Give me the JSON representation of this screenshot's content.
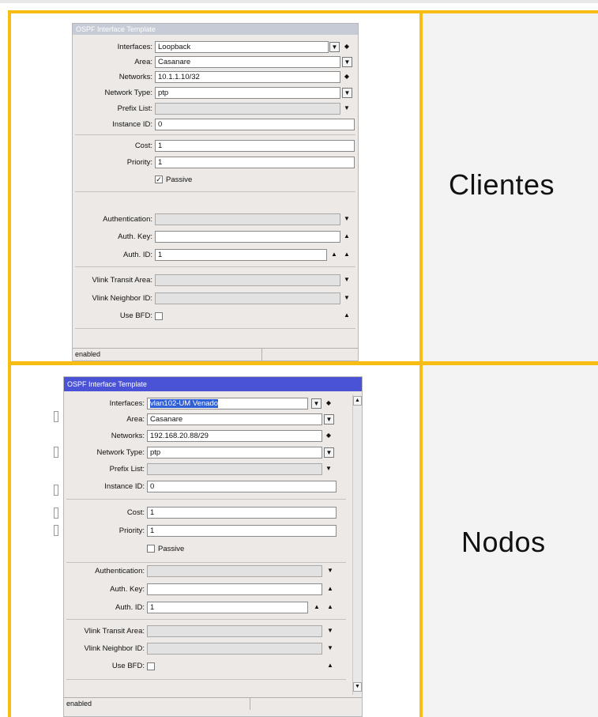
{
  "row1": {
    "label": "Clientes",
    "dialog": {
      "title": "OSPF Interface Template",
      "fields": {
        "interfaces": {
          "label": "Interfaces:",
          "value": "Loopback"
        },
        "area": {
          "label": "Area:",
          "value": "Casanare"
        },
        "networks": {
          "label": "Networks:",
          "value": "10.1.1.10/32"
        },
        "network_type": {
          "label": "Network Type:",
          "value": "ptp"
        },
        "prefix_list": {
          "label": "Prefix List:",
          "value": ""
        },
        "instance_id": {
          "label": "Instance ID:",
          "value": "0"
        },
        "cost": {
          "label": "Cost:",
          "value": "1"
        },
        "priority": {
          "label": "Priority:",
          "value": "1"
        },
        "passive": {
          "label": "Passive",
          "checked": true
        },
        "authentication": {
          "label": "Authentication:",
          "value": ""
        },
        "auth_key": {
          "label": "Auth. Key:",
          "value": ""
        },
        "auth_id": {
          "label": "Auth. ID:",
          "value": "1"
        },
        "vlink_transit_area": {
          "label": "Vlink Transit Area:",
          "value": ""
        },
        "vlink_neighbor_id": {
          "label": "Vlink Neighbor ID:",
          "value": ""
        },
        "use_bfd": {
          "label": "Use BFD:",
          "checked": false
        }
      },
      "status": "enabled"
    }
  },
  "row2": {
    "label": "Nodos",
    "dialog": {
      "title": "OSPF Interface Template",
      "fields": {
        "interfaces": {
          "label": "Interfaces:",
          "value": "vlan102-UM Venado"
        },
        "area": {
          "label": "Area:",
          "value": "Casanare"
        },
        "networks": {
          "label": "Networks:",
          "value": "192.168.20.88/29"
        },
        "network_type": {
          "label": "Network Type:",
          "value": "ptp"
        },
        "prefix_list": {
          "label": "Prefix List:",
          "value": ""
        },
        "instance_id": {
          "label": "Instance ID:",
          "value": "0"
        },
        "cost": {
          "label": "Cost:",
          "value": "1"
        },
        "priority": {
          "label": "Priority:",
          "value": "1"
        },
        "passive": {
          "label": "Passive",
          "checked": false
        },
        "authentication": {
          "label": "Authentication:",
          "value": ""
        },
        "auth_key": {
          "label": "Auth. Key:",
          "value": ""
        },
        "auth_id": {
          "label": "Auth. ID:",
          "value": "1"
        },
        "vlink_transit_area": {
          "label": "Vlink Transit Area:",
          "value": ""
        },
        "vlink_neighbor_id": {
          "label": "Vlink Neighbor ID:",
          "value": ""
        },
        "use_bfd": {
          "label": "Use BFD:",
          "checked": false
        }
      },
      "status": "enabled"
    }
  },
  "icons": {
    "dropdown": "▼",
    "updown": "◆",
    "up": "▲",
    "check": "✓"
  },
  "colors": {
    "grid_border": "#f7bd15",
    "active_title": "#4a52d6",
    "inactive_title": "#c6cbd6"
  }
}
